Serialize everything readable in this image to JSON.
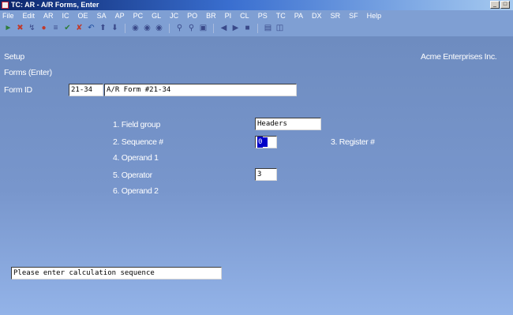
{
  "window": {
    "title": "TC: AR - A/R Forms, Enter",
    "buttons": [
      "_",
      "□"
    ]
  },
  "menu": [
    "File",
    "Edit",
    "AR",
    "IC",
    "OE",
    "SA",
    "AP",
    "PC",
    "GL",
    "JC",
    "PO",
    "BR",
    "PI",
    "CL",
    "PS",
    "TC",
    "PA",
    "DX",
    "SR",
    "SF",
    "Help"
  ],
  "toolbar": {
    "icons": [
      "go-icon",
      "stop-icon",
      "lookup-icon",
      "delete-icon",
      "print-icon",
      "check-icon",
      "undo-icon",
      "up-icon",
      "down-icon",
      "circle-icon-1",
      "circle-icon-2",
      "circle-icon-3",
      "find-icon",
      "zoom-icon",
      "calc-icon",
      "prev-icon",
      "next-icon",
      "home-icon",
      "save-icon",
      "help-icon"
    ]
  },
  "header": {
    "module": "Setup",
    "company": "Acme Enterprises Inc.",
    "screen": "Forms (Enter)"
  },
  "form_id": {
    "label": "Form ID",
    "value": "21-34",
    "description": "A/R Form #21-34"
  },
  "fields": {
    "field_group": {
      "label": "1. Field group",
      "value": "Headers"
    },
    "sequence": {
      "label": "2. Sequence #",
      "value": "0"
    },
    "register": {
      "label": "3. Register #"
    },
    "operand1": {
      "label": "4. Operand 1"
    },
    "operator": {
      "label": "5. Operator",
      "value": "3"
    },
    "operand2": {
      "label": "6. Operand 2"
    }
  },
  "status": {
    "message": "Please enter calculation sequence"
  }
}
